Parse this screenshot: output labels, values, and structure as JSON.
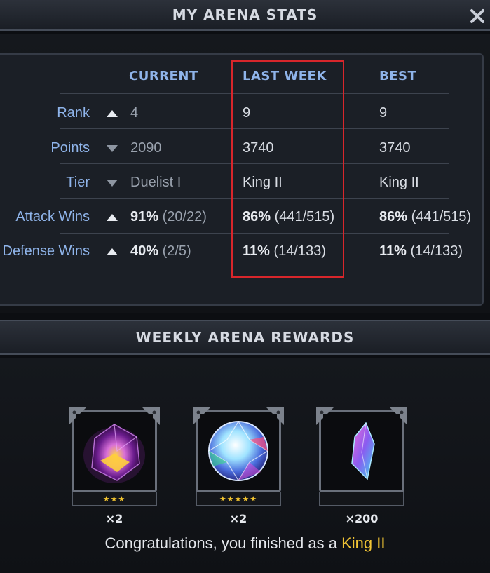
{
  "header": {
    "title": "MY ARENA STATS",
    "close_icon": "close-icon"
  },
  "stats": {
    "columns": {
      "current": "CURRENT",
      "last_week": "LAST WEEK",
      "best": "BEST"
    },
    "rows": [
      {
        "label": "Rank",
        "trend": "up",
        "current": "4",
        "last_week": "9",
        "best": "9"
      },
      {
        "label": "Points",
        "trend": "down",
        "current": "2090",
        "last_week": "3740",
        "best": "3740"
      },
      {
        "label": "Tier",
        "trend": "down",
        "current": "Duelist I",
        "last_week": "King II",
        "best": "King II"
      },
      {
        "label": "Attack Wins",
        "trend": "up",
        "current_pct": "91%",
        "current_ratio": " (20/22)",
        "last_week_pct": "86%",
        "last_week_ratio": " (441/515)",
        "best_pct": "86%",
        "best_ratio": " (441/515)"
      },
      {
        "label": "Defense Wins",
        "trend": "up",
        "current_pct": "40%",
        "current_ratio": " (2/5)",
        "last_week_pct": "11%",
        "last_week_ratio": " (14/133)",
        "best_pct": "11%",
        "best_ratio": " (14/133)"
      }
    ],
    "highlight_color": "#d8262b"
  },
  "rewards": {
    "title": "WEEKLY ARENA REWARDS",
    "items": [
      {
        "icon": "crystal-icon",
        "stars": "★★★",
        "quantity": "×2"
      },
      {
        "icon": "gem-icon",
        "stars": "★★★★★",
        "quantity": "×2"
      },
      {
        "icon": "shard-icon",
        "stars": "",
        "quantity": "×200"
      }
    ],
    "message_prefix": "Congratulations, you finished as a ",
    "message_rank": "King II"
  },
  "colors": {
    "label_blue": "#8fb4ea",
    "star_gold": "#f3c52f",
    "rank_gold": "#f2c535"
  }
}
